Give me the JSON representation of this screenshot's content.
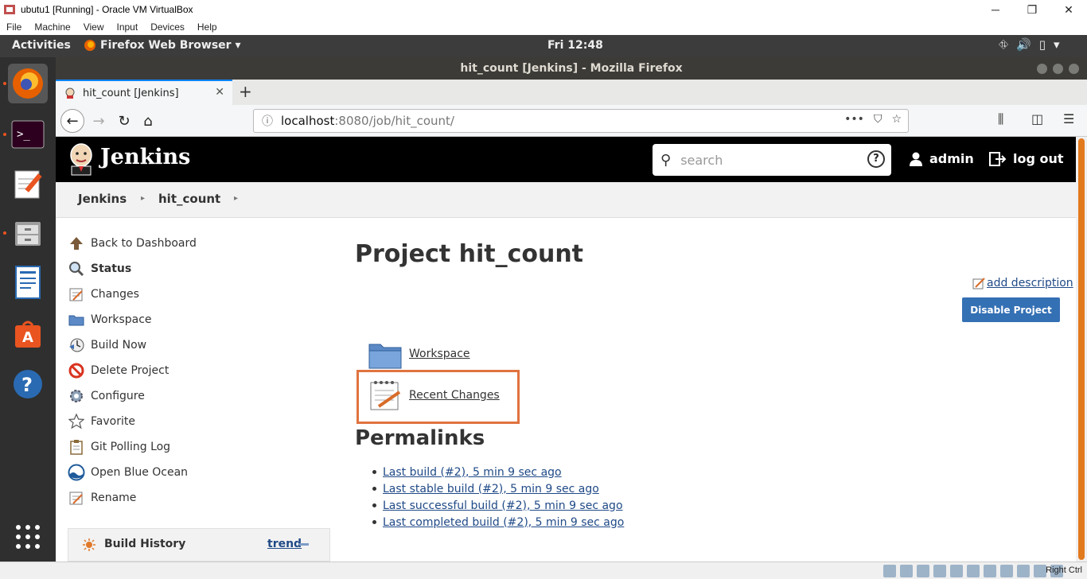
{
  "vbox": {
    "title": "ubutu1 [Running] - Oracle VM VirtualBox",
    "menu": [
      "File",
      "Machine",
      "View",
      "Input",
      "Devices",
      "Help"
    ],
    "host_key": "Right Ctrl"
  },
  "ubuntu": {
    "activities": "Activities",
    "app_menu": "Firefox Web Browser ▾",
    "clock": "Fri 12:48"
  },
  "firefox": {
    "window_title": "hit_count [Jenkins] - Mozilla Firefox",
    "tab_label": "hit_count [Jenkins]",
    "url_host": "localhost",
    "url_rest": ":8080/job/hit_count/"
  },
  "jenkins": {
    "brand": "Jenkins",
    "search_placeholder": "search",
    "user": "admin",
    "logout": "log out",
    "breadcrumbs": [
      "Jenkins",
      "hit_count"
    ]
  },
  "side_tasks": [
    {
      "label": "Back to Dashboard",
      "icon": "up-arrow-icon"
    },
    {
      "label": "Status",
      "icon": "magnifier-icon"
    },
    {
      "label": "Changes",
      "icon": "notepad-icon"
    },
    {
      "label": "Workspace",
      "icon": "folder-icon"
    },
    {
      "label": "Build Now",
      "icon": "build-clock-icon"
    },
    {
      "label": "Delete Project",
      "icon": "no-entry-icon"
    },
    {
      "label": "Configure",
      "icon": "gear-icon"
    },
    {
      "label": "Favorite",
      "icon": "star-icon"
    },
    {
      "label": "Git Polling Log",
      "icon": "clipboard-icon"
    },
    {
      "label": "Open Blue Ocean",
      "icon": "blue-ocean-icon"
    },
    {
      "label": "Rename",
      "icon": "notepad-icon"
    }
  ],
  "build_history": {
    "title": "Build History",
    "trend": "trend"
  },
  "main": {
    "title": "Project hit_count",
    "add_description": "add description",
    "disable_button": "Disable Project",
    "workspace_link": "Workspace",
    "recent_changes_link": "Recent Changes",
    "permalinks_title": "Permalinks",
    "permalinks": [
      "Last build (#2), 5 min 9 sec ago",
      "Last stable build (#2), 5 min 9 sec ago",
      "Last successful build (#2), 5 min 9 sec ago",
      "Last completed build (#2), 5 min 9 sec ago"
    ]
  },
  "colors": {
    "jenkins_header": "#000000",
    "link": "#204a87",
    "button": "#3470b4",
    "highlight": "#e0733f",
    "ubuntu_accent": "#e95420"
  }
}
